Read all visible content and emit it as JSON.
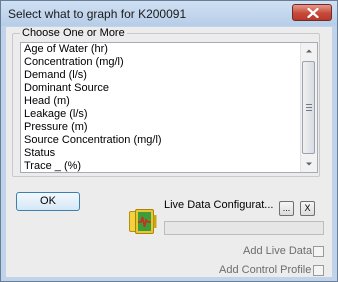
{
  "window": {
    "title": "Select what to graph for K200091",
    "close_icon": "close-x-icon"
  },
  "group": {
    "legend": "Choose One or More",
    "items": [
      "Age of Water (hr)",
      "Concentration (mg/l)",
      "Demand (l/s)",
      "Dominant Source",
      "Head (m)",
      "Leakage (l/s)",
      "Pressure (m)",
      "Source Concentration (mg/l)",
      "Status",
      "Trace _ (%)"
    ]
  },
  "buttons": {
    "ok": "OK",
    "browse": "...",
    "clear": "X"
  },
  "live_data": {
    "label": "Live Data Configurat...",
    "icon": "live-data-monitor-icon",
    "progress": 0
  },
  "options": {
    "add_live_data": "Add Live Data",
    "add_live_data_checked": false,
    "add_control_profile": "Add Control Profile",
    "add_control_profile_checked": false
  }
}
